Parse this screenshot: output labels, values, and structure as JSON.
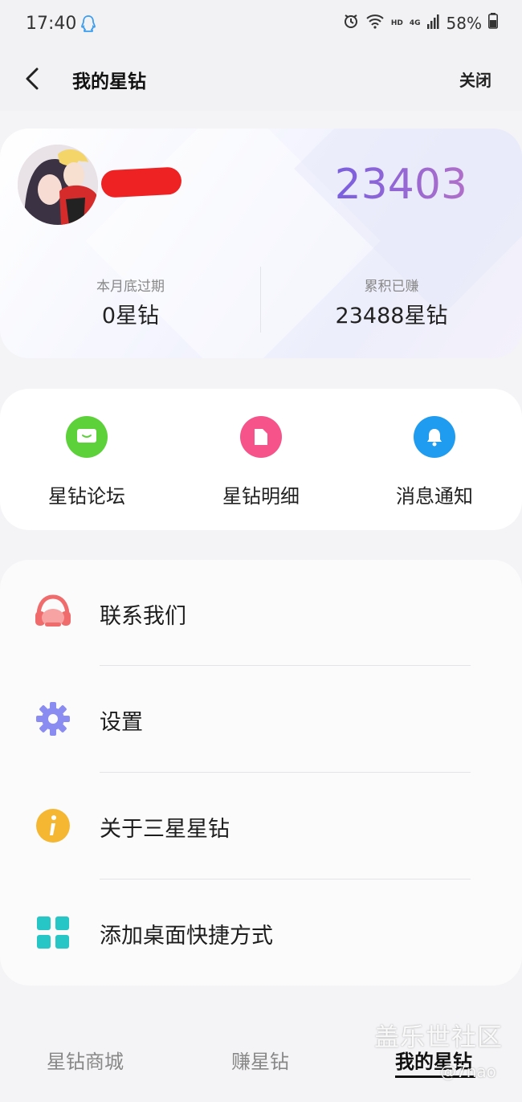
{
  "status_bar": {
    "time": "17:40",
    "network_hd": "HD",
    "network_4g": "4G",
    "battery": "58%"
  },
  "header": {
    "title": "我的星钻",
    "close_label": "关闭"
  },
  "summary": {
    "balance": "23403",
    "expiring": {
      "label": "本月底过期",
      "value": "0星钻"
    },
    "earned": {
      "label": "累积已赚",
      "value": "23488星钻"
    }
  },
  "quick_actions": [
    {
      "label": "星钻论坛",
      "icon": "chat-icon",
      "color": "#5cd13a"
    },
    {
      "label": "星钻明细",
      "icon": "document-icon",
      "color": "#f5538a"
    },
    {
      "label": "消息通知",
      "icon": "bell-icon",
      "color": "#1f9bf0"
    }
  ],
  "menu": [
    {
      "label": "联系我们",
      "icon": "headset-icon",
      "color": "#f06b6b"
    },
    {
      "label": "设置",
      "icon": "gear-icon",
      "color": "#8a8cf2"
    },
    {
      "label": "关于三星星钻",
      "icon": "info-icon",
      "color": "#f5b731"
    },
    {
      "label": "添加桌面快捷方式",
      "icon": "grid-icon",
      "color": "#26c6c6"
    }
  ],
  "tabs": [
    {
      "label": "星钻商城",
      "active": false
    },
    {
      "label": "赚星钻",
      "active": false
    },
    {
      "label": "我的星钻",
      "active": true
    }
  ],
  "watermark": {
    "line1": "盖乐世社区",
    "line2": "@7nao"
  }
}
